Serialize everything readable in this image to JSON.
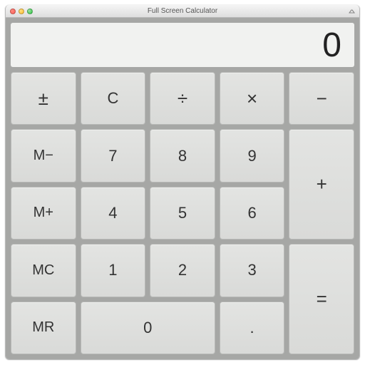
{
  "window": {
    "title": "Full Screen Calculator"
  },
  "display": {
    "value": "0"
  },
  "keys": {
    "plusminus": "±",
    "clear": "C",
    "divide": "÷",
    "multiply": "×",
    "minus": "−",
    "mminus": "M−",
    "seven": "7",
    "eight": "8",
    "nine": "9",
    "plus": "+",
    "mplus": "M+",
    "four": "4",
    "five": "5",
    "six": "6",
    "mc": "MC",
    "one": "1",
    "two": "2",
    "three": "3",
    "equals": "=",
    "mr": "MR",
    "zero": "0",
    "dot": "."
  }
}
